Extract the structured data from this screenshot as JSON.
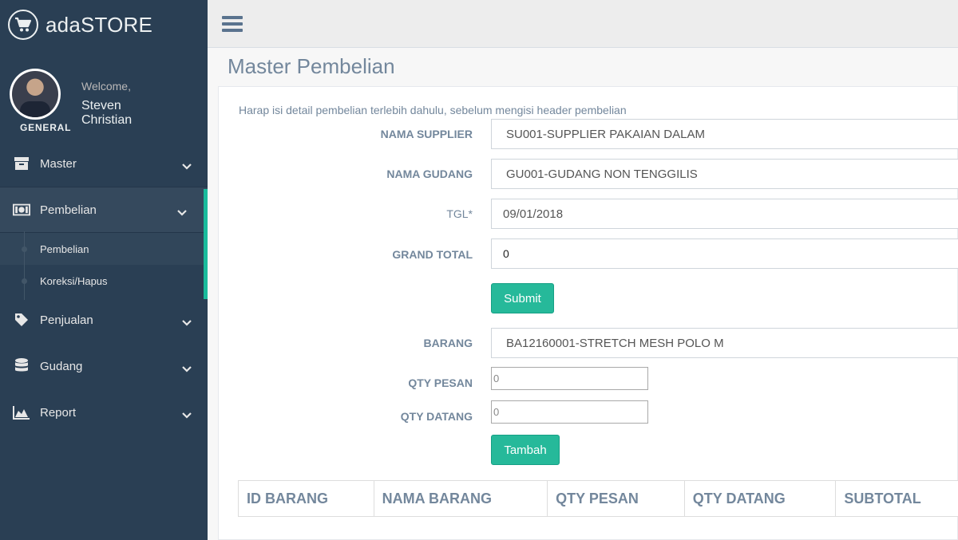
{
  "brand": {
    "title": "adaSTORE"
  },
  "profile": {
    "welcome": "Welcome,",
    "name": "Steven Christian",
    "role": "GENERAL"
  },
  "menu": [
    {
      "label": "Master",
      "icon": "archive-icon"
    },
    {
      "label": "Pembelian",
      "icon": "money-icon",
      "active": true,
      "children": [
        {
          "label": "Pembelian",
          "current": true
        },
        {
          "label": "Koreksi/Hapus"
        }
      ]
    },
    {
      "label": "Penjualan",
      "icon": "tag-icon"
    },
    {
      "label": "Gudang",
      "icon": "database-icon"
    },
    {
      "label": "Report",
      "icon": "area-chart-icon"
    }
  ],
  "page": {
    "title": "Master Pembelian"
  },
  "form": {
    "hint": "Harap isi detail pembelian terlebih dahulu, sebelum mengisi header pembelian",
    "supplier": {
      "label": "NAMA SUPPLIER",
      "value": "SU001-SUPPLIER PAKAIAN DALAM"
    },
    "gudang": {
      "label": "NAMA GUDANG",
      "value": "GU001-GUDANG NON TENGGILIS"
    },
    "tgl": {
      "label": "TGL*",
      "value": "09/01/2018"
    },
    "grand_total": {
      "label": "GRAND TOTAL",
      "value": "0"
    },
    "submit_label": "Submit",
    "barang": {
      "label": "BARANG",
      "value": "BA12160001-STRETCH MESH POLO M"
    },
    "qty_pesan": {
      "label": "QTY PESAN",
      "value": "0"
    },
    "qty_datang": {
      "label": "QTY DATANG",
      "value": "0"
    },
    "tambah_label": "Tambah"
  },
  "table": {
    "columns": [
      "ID BARANG",
      "NAMA BARANG",
      "QTY PESAN",
      "QTY DATANG",
      "SUBTOTAL"
    ]
  },
  "colors": {
    "sidebar": "#2a3f54",
    "accent": "#26b99a"
  }
}
